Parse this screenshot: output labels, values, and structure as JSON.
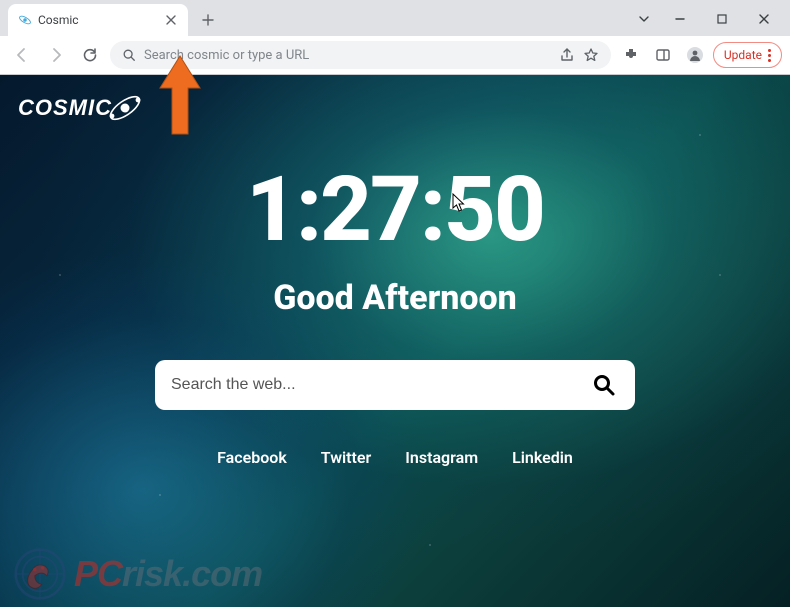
{
  "browser": {
    "tab_title": "Cosmic",
    "omnibox_placeholder": "Search cosmic or type a URL",
    "update_label": "Update"
  },
  "page": {
    "logo": "COSMIC",
    "clock": "1:27:50",
    "greeting": "Good Afternoon",
    "search_placeholder": "Search the web...",
    "links": [
      "Facebook",
      "Twitter",
      "Instagram",
      "Linkedin"
    ]
  },
  "watermark": {
    "pc": "PC",
    "rest": "risk.com"
  }
}
